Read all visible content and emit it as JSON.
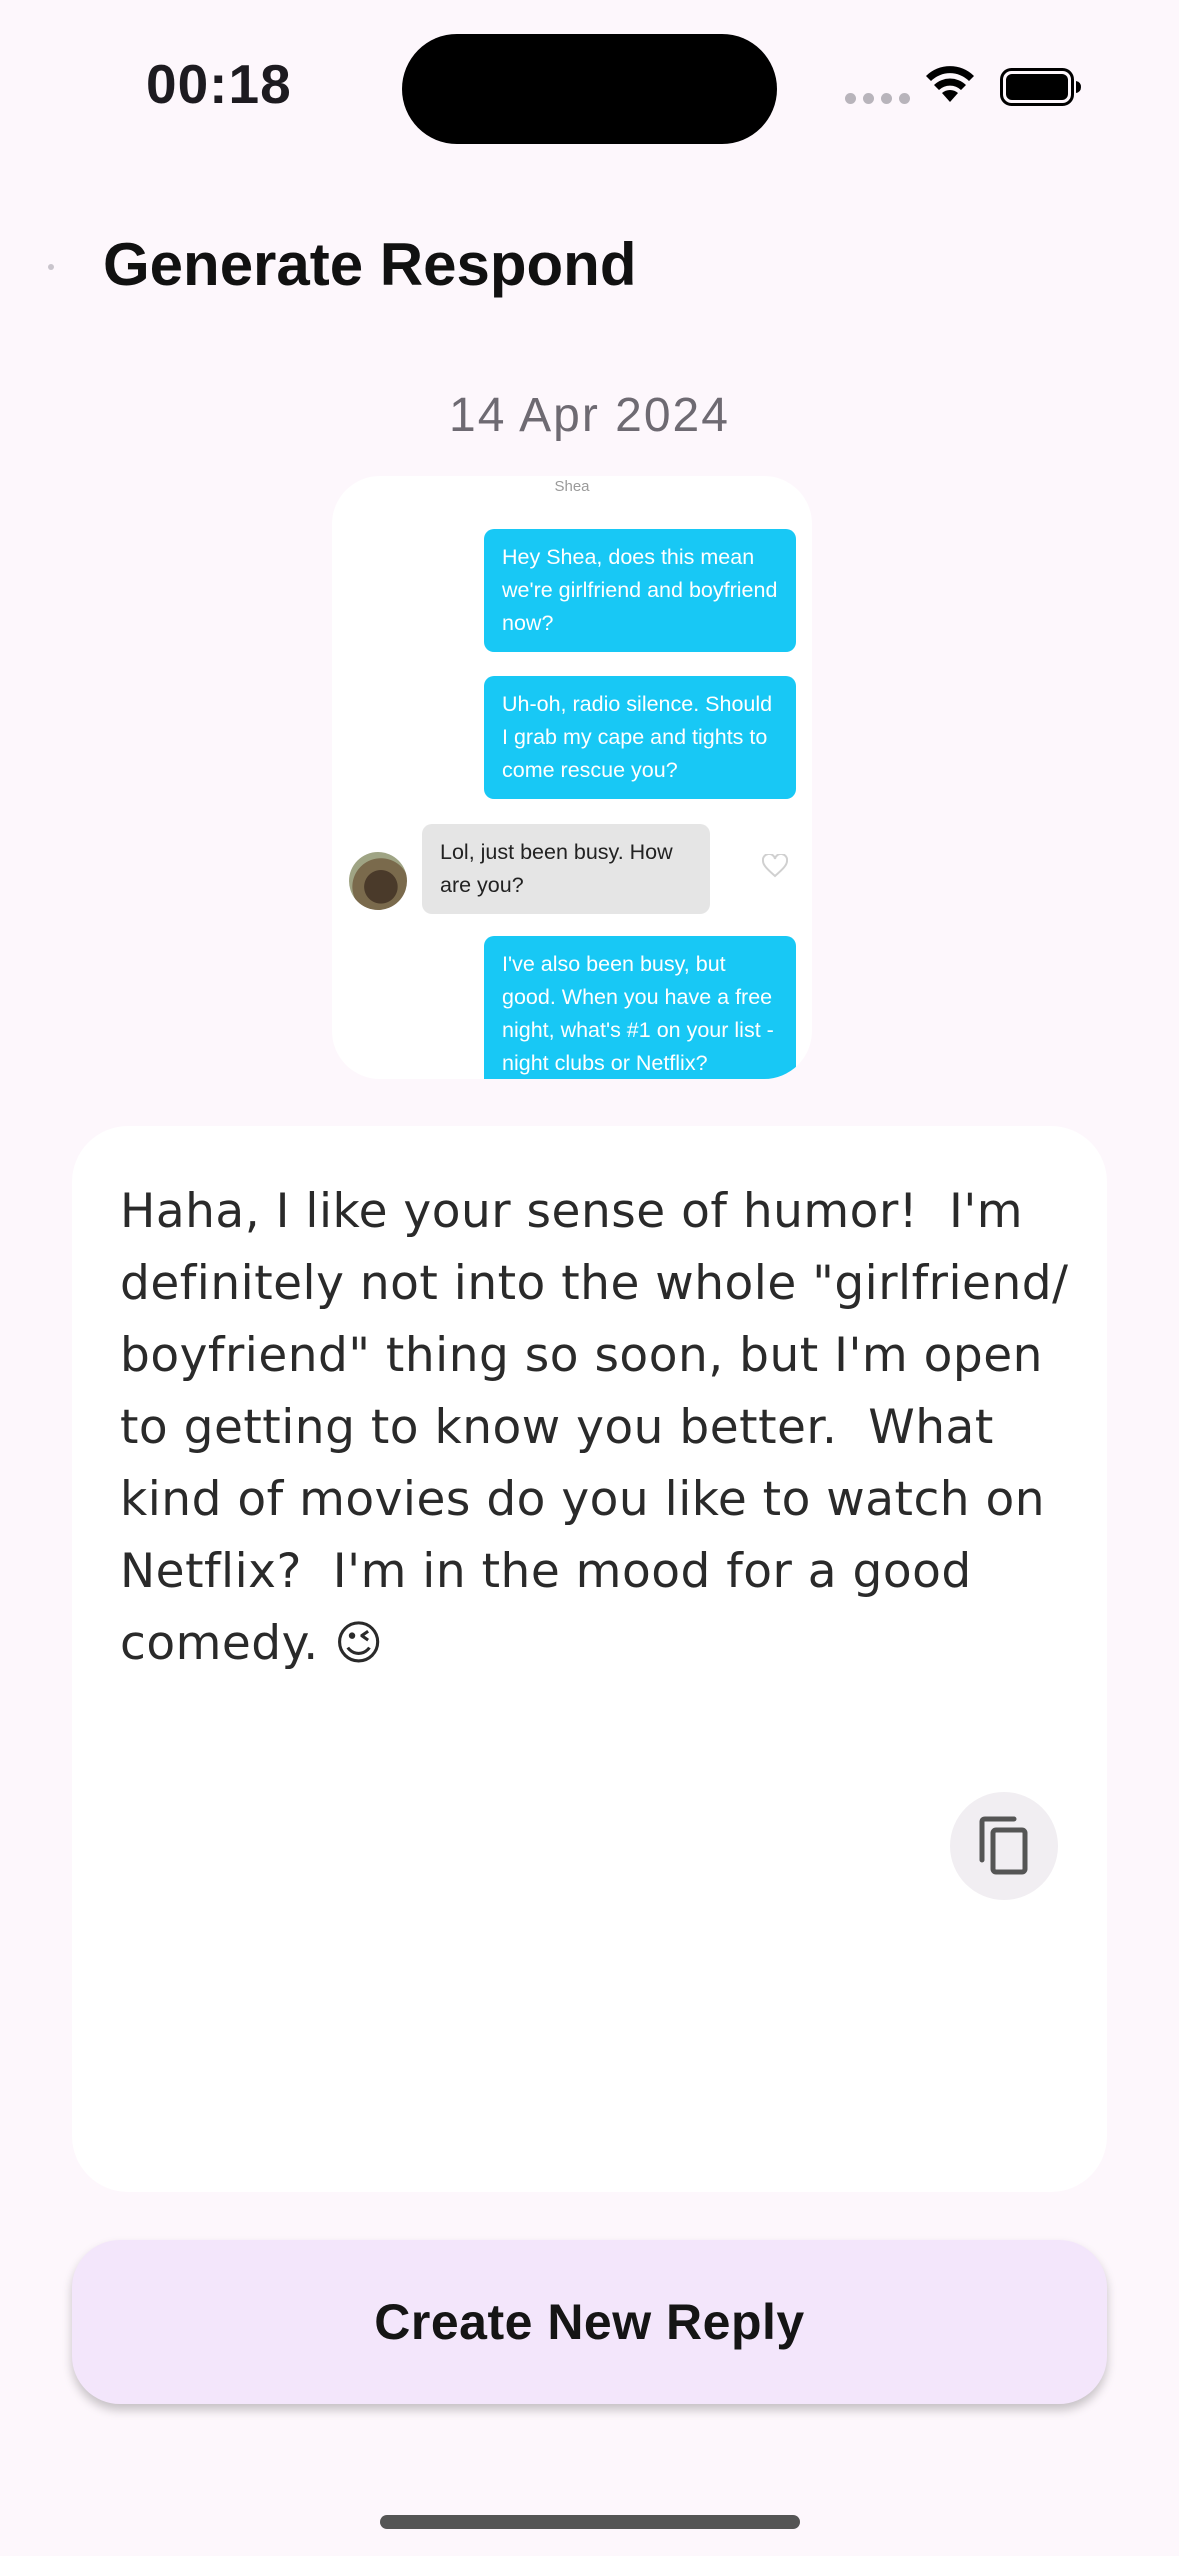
{
  "status_bar": {
    "time": "00:18"
  },
  "header": {
    "title": "Generate Respond"
  },
  "conversation": {
    "date": "14 Apr 2024",
    "screenshot": {
      "contact_name": "Shea",
      "messages": [
        {
          "side": "right",
          "text": "Hey Shea, does this mean we're girlfriend and boyfriend now?"
        },
        {
          "side": "right",
          "text": "Uh-oh, radio silence. Should I grab my cape and tights to come rescue you?"
        },
        {
          "side": "left",
          "text": "Lol, just been busy. How are you?"
        },
        {
          "side": "right",
          "text": "I've also been busy, but good. When you have a free night, what's #1 on your list - night clubs or Netflix?"
        }
      ]
    }
  },
  "reply_card": {
    "text": "Haha, I like your sense of humor!  I'm definitely not into the whole \"girlfriend/ boyfriend\" thing so soon, but I'm open to getting to know you better.  What kind of movies do you like to watch on Netflix?  I'm in the mood for a good comedy. 😉",
    "copy_icon": "copy-icon"
  },
  "actions": {
    "create_new_reply_label": "Create New Reply"
  },
  "colors": {
    "background": "#fdf7fc",
    "sent_bubble": "#18c8f5",
    "received_bubble": "#e5e5e5",
    "cta_background": "#f3e6fb"
  }
}
